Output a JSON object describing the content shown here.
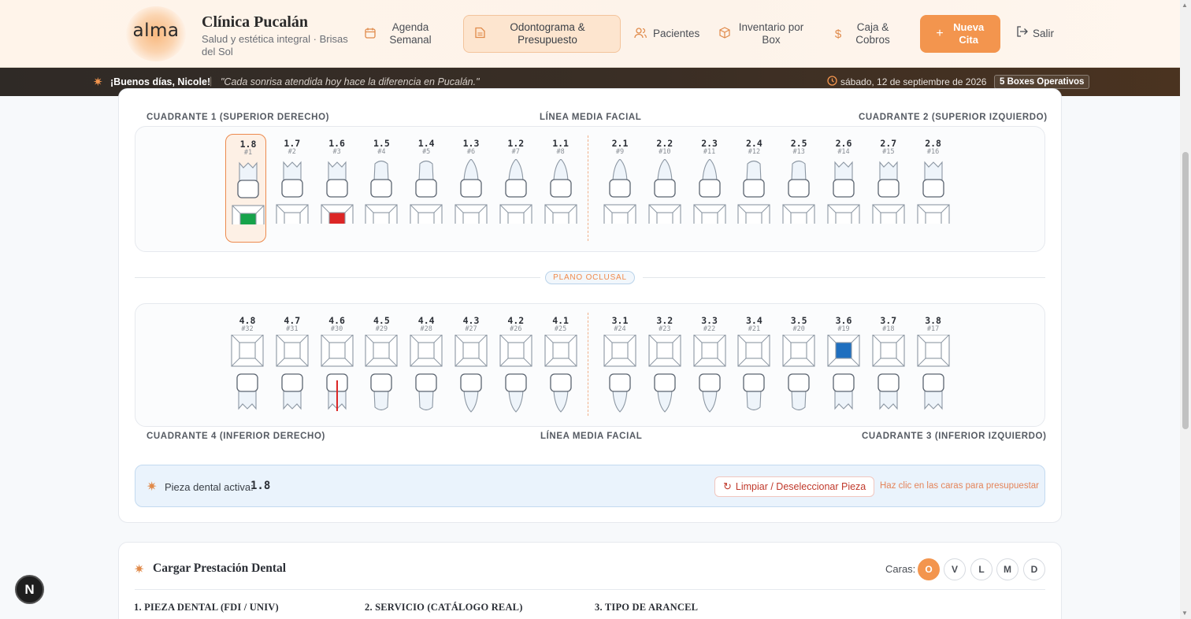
{
  "brand": {
    "logo": "alma",
    "clinic_name": "Clínica Pucalán",
    "clinic_sub": "Salud y estética integral · Brisas del Sol"
  },
  "nav": [
    {
      "id": "agenda",
      "label": "Agenda Semanal",
      "icon": "calendar-icon",
      "active": false
    },
    {
      "id": "odontograma",
      "label": "Odontograma & Presupuesto",
      "icon": "document-icon",
      "active": true
    },
    {
      "id": "pacientes",
      "label": "Pacientes",
      "icon": "users-icon",
      "active": false
    },
    {
      "id": "inventario",
      "label": "Inventario por Box",
      "icon": "box-icon",
      "active": false
    },
    {
      "id": "caja",
      "label": "Caja & Cobros",
      "icon": "dollar-icon",
      "active": false
    }
  ],
  "new_appointment": "Nueva Cita",
  "logout": "Salir",
  "greeting": {
    "hello": "¡Buenos días, Nicole!",
    "quote": "\"Cada sonrisa atendida hoy hace la diferencia en Pucalán.\"",
    "date": "sábado, 12 de septiembre de 2026",
    "boxes": "5 Boxes Operativos"
  },
  "odontogram": {
    "q1_label": "CUADRANTE 1 (SUPERIOR DERECHO)",
    "q2_label": "CUADRANTE 2 (SUPERIOR IZQUIERDO)",
    "q3_label": "CUADRANTE 3 (INFERIOR IZQUIERDO)",
    "q4_label": "CUADRANTE 4 (INFERIOR DERECHO)",
    "midline_top": "LÍNEA MEDIA FACIAL",
    "midline_bottom": "LÍNEA MEDIA FACIAL",
    "occlusal": "PLANO OCLUSAL",
    "colors": {
      "green": "#16a34a",
      "red": "#dc2626",
      "blue": "#1f6fbf",
      "accent": "#f3954e"
    },
    "upper": [
      {
        "fdi": "1.8",
        "univ": "#1",
        "root": "molar",
        "fill": "green",
        "selected": true
      },
      {
        "fdi": "1.7",
        "univ": "#2",
        "root": "molar"
      },
      {
        "fdi": "1.6",
        "univ": "#3",
        "root": "molar",
        "fill": "red"
      },
      {
        "fdi": "1.5",
        "univ": "#4",
        "root": "premolar"
      },
      {
        "fdi": "1.4",
        "univ": "#5",
        "root": "premolar"
      },
      {
        "fdi": "1.3",
        "univ": "#6",
        "root": "canine"
      },
      {
        "fdi": "1.2",
        "univ": "#7",
        "root": "canine"
      },
      {
        "fdi": "1.1",
        "univ": "#8",
        "root": "canine"
      },
      {
        "fdi": "2.1",
        "univ": "#9",
        "root": "canine"
      },
      {
        "fdi": "2.2",
        "univ": "#10",
        "root": "canine"
      },
      {
        "fdi": "2.3",
        "univ": "#11",
        "root": "canine"
      },
      {
        "fdi": "2.4",
        "univ": "#12",
        "root": "premolar"
      },
      {
        "fdi": "2.5",
        "univ": "#13",
        "root": "premolar"
      },
      {
        "fdi": "2.6",
        "univ": "#14",
        "root": "molar"
      },
      {
        "fdi": "2.7",
        "univ": "#15",
        "root": "molar"
      },
      {
        "fdi": "2.8",
        "univ": "#16",
        "root": "molar"
      }
    ],
    "lower": [
      {
        "fdi": "4.8",
        "univ": "#32",
        "root": "molar"
      },
      {
        "fdi": "4.7",
        "univ": "#31",
        "root": "molar"
      },
      {
        "fdi": "4.6",
        "univ": "#30",
        "root": "molar",
        "endo": true
      },
      {
        "fdi": "4.5",
        "univ": "#29",
        "root": "premolar"
      },
      {
        "fdi": "4.4",
        "univ": "#28",
        "root": "premolar"
      },
      {
        "fdi": "4.3",
        "univ": "#27",
        "root": "canine"
      },
      {
        "fdi": "4.2",
        "univ": "#26",
        "root": "canine"
      },
      {
        "fdi": "4.1",
        "univ": "#25",
        "root": "canine"
      },
      {
        "fdi": "3.1",
        "univ": "#24",
        "root": "canine"
      },
      {
        "fdi": "3.2",
        "univ": "#23",
        "root": "canine"
      },
      {
        "fdi": "3.3",
        "univ": "#22",
        "root": "canine"
      },
      {
        "fdi": "3.4",
        "univ": "#21",
        "root": "premolar"
      },
      {
        "fdi": "3.5",
        "univ": "#20",
        "root": "premolar"
      },
      {
        "fdi": "3.6",
        "univ": "#19",
        "root": "molar",
        "fill": "blue"
      },
      {
        "fdi": "3.7",
        "univ": "#18",
        "root": "molar"
      },
      {
        "fdi": "3.8",
        "univ": "#17",
        "root": "molar"
      }
    ]
  },
  "active_piece": {
    "label": "Pieza dental activa:",
    "value": "1.8",
    "clear_btn": "Limpiar / Deseleccionar Pieza",
    "hint": "Haz clic en las caras para presupuestar"
  },
  "load_service": {
    "title": "Cargar Prestación Dental",
    "faces_label": "Caras:",
    "faces": [
      {
        "label": "O",
        "active": true
      },
      {
        "label": "V",
        "active": false
      },
      {
        "label": "L",
        "active": false
      },
      {
        "label": "M",
        "active": false
      },
      {
        "label": "D",
        "active": false
      }
    ],
    "field1": "1. PIEZA DENTAL (FDI / UNIV)",
    "field2": "2. SERVICIO (CATÁLOGO REAL)",
    "field3": "3. TIPO DE ARANCEL"
  },
  "badge": "N"
}
